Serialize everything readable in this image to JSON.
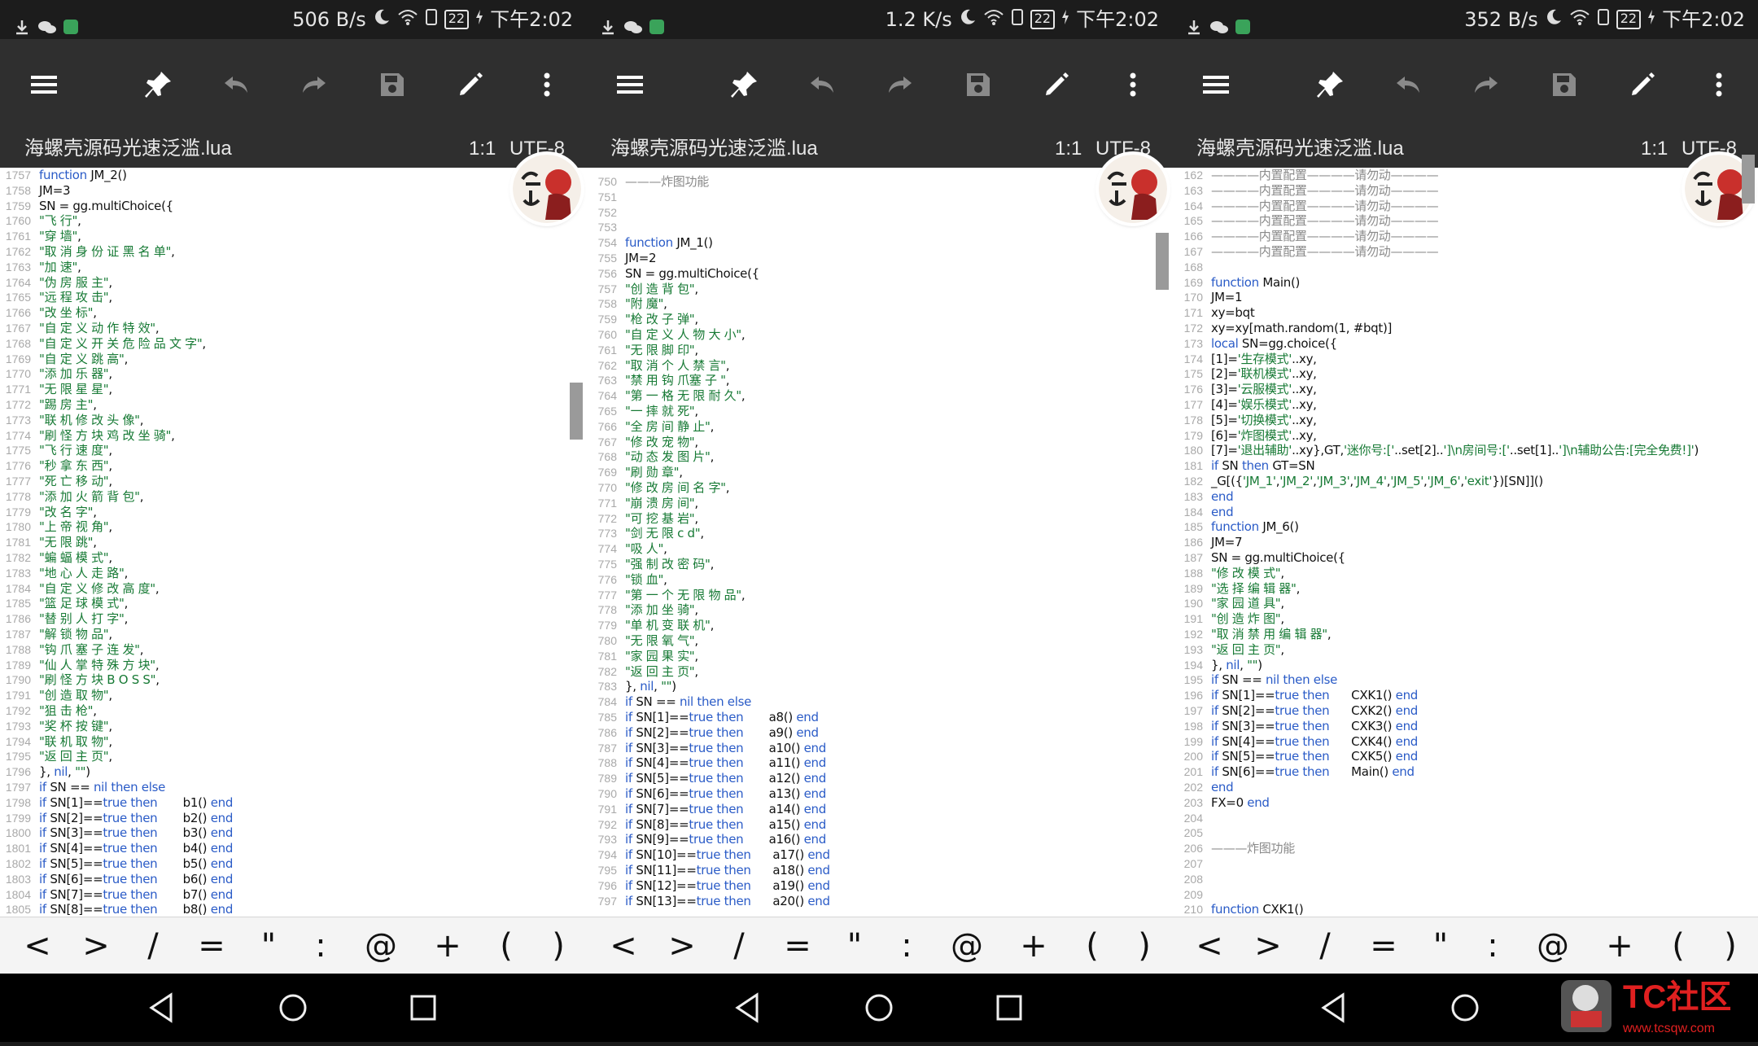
{
  "panels": [
    {
      "status": {
        "speed": "506 B/s",
        "battery": "22",
        "time": "下午2:02"
      },
      "file": {
        "name": "海螺壳源码光速泛滥.lua",
        "position": "1:1",
        "encoding": "UTF-8"
      },
      "lines": [
        [
          "1757",
          "function JM_2()"
        ],
        [
          "1758",
          "JM=3"
        ],
        [
          "1759",
          "SN = gg.multiChoice({"
        ],
        [
          "1760",
          "\"飞 行\","
        ],
        [
          "1761",
          "\"穿 墙\","
        ],
        [
          "1762",
          "\"取 消 身 份 证 黑 名 单\","
        ],
        [
          "1763",
          "\"加 速\","
        ],
        [
          "1764",
          "\"伪 房 服 主\","
        ],
        [
          "1765",
          "\"远 程 攻 击\","
        ],
        [
          "1766",
          "\"改 坐 标\","
        ],
        [
          "1767",
          "\"自 定 义 动 作 特 效\","
        ],
        [
          "1768",
          "\"自 定 义 开 关 危 险 品 文 字\","
        ],
        [
          "1769",
          "\"自 定 义 跳 高\","
        ],
        [
          "1770",
          "\"添 加 乐 器\","
        ],
        [
          "1771",
          "\"无 限 星 星\","
        ],
        [
          "1772",
          "\"踢 房 主\","
        ],
        [
          "1773",
          "\"联 机 修 改 头 像\","
        ],
        [
          "1774",
          "\"刷 怪 方 块 鸡 改 坐 骑\","
        ],
        [
          "1775",
          "\"飞 行 速 度\","
        ],
        [
          "1776",
          "\"秒 拿 东 西\","
        ],
        [
          "1777",
          "\"死 亡 移 动\","
        ],
        [
          "1778",
          "\"添 加 火 箭 背 包\","
        ],
        [
          "1779",
          "\"改 名 字\","
        ],
        [
          "1780",
          "\"上 帝 视 角\","
        ],
        [
          "1781",
          "\"无 限 跳\","
        ],
        [
          "1782",
          "\"蝙 蝠 模 式\","
        ],
        [
          "1783",
          "\"地 心 人 走 路\","
        ],
        [
          "1784",
          "\"自 定 义 修 改 高 度\","
        ],
        [
          "1785",
          "\"篮 足 球 模 式\","
        ],
        [
          "1786",
          "\"替 别 人 打 字\","
        ],
        [
          "1787",
          "\"解 锁 物 品\","
        ],
        [
          "1788",
          "\"钩 爪 塞 子 连 发\","
        ],
        [
          "1789",
          "\"仙 人 掌 特 殊 方 块\","
        ],
        [
          "1790",
          "\"刷 怪 方 块 B O S S\","
        ],
        [
          "1791",
          "\"创 造 取 物\","
        ],
        [
          "1792",
          "\"狙 击 枪\","
        ],
        [
          "1793",
          "\"奖 杯 按 键\","
        ],
        [
          "1794",
          "\"联 机 取 物\","
        ],
        [
          "1795",
          "\"返 回 主 页\","
        ],
        [
          "1796",
          "}, nil, \"\")"
        ],
        [
          "1797",
          "if SN == nil then else"
        ],
        [
          "1798",
          "if SN[1]==true then       b1() end"
        ],
        [
          "1799",
          "if SN[2]==true then       b2() end"
        ],
        [
          "1800",
          "if SN[3]==true then       b3() end"
        ],
        [
          "1801",
          "if SN[4]==true then       b4() end"
        ],
        [
          "1802",
          "if SN[5]==true then       b5() end"
        ],
        [
          "1803",
          "if SN[6]==true then       b6() end"
        ],
        [
          "1804",
          "if SN[7]==true then       b7() end"
        ],
        [
          "1805",
          "if SN[8]==true then       b8() end"
        ]
      ]
    },
    {
      "status": {
        "speed": "1.2 K/s",
        "battery": "22",
        "time": "下午2:02"
      },
      "file": {
        "name": "海螺壳源码光速泛滥.lua",
        "position": "1:1",
        "encoding": "UTF-8"
      },
      "lines": [
        [
          "750",
          "———炸图功能"
        ],
        [
          "751",
          ""
        ],
        [
          "752",
          ""
        ],
        [
          "753",
          ""
        ],
        [
          "754",
          "function JM_1()"
        ],
        [
          "755",
          "JM=2"
        ],
        [
          "756",
          "SN = gg.multiChoice({"
        ],
        [
          "757",
          "\"创 造 背 包\","
        ],
        [
          "758",
          "\"附 魔\","
        ],
        [
          "759",
          "\"枪 改 子 弹\","
        ],
        [
          "760",
          "\"自 定 义 人 物 大 小\","
        ],
        [
          "761",
          "\"无 限 脚 印\","
        ],
        [
          "762",
          "\"取 消 个 人 禁 言\","
        ],
        [
          "763",
          "\"禁 用 钩 爪塞 子 \","
        ],
        [
          "764",
          "\"第 一 格 无 限 耐 久\","
        ],
        [
          "765",
          "\"一 摔 就 死\","
        ],
        [
          "766",
          "\"全 房 间 静 止\","
        ],
        [
          "767",
          "\"修 改 宠 物\","
        ],
        [
          "768",
          "\"动 态 发 图 片\","
        ],
        [
          "769",
          "\"刷 勋 章\","
        ],
        [
          "770",
          "\"修 改 房 间 名 字\","
        ],
        [
          "771",
          "\"崩 溃 房 间\","
        ],
        [
          "772",
          "\"可 挖 基 岩\","
        ],
        [
          "773",
          "\"剑 无 限 c d\","
        ],
        [
          "774",
          "\"吸 人\","
        ],
        [
          "775",
          "\"强 制 改 密 码\","
        ],
        [
          "776",
          "\"锁 血\","
        ],
        [
          "777",
          "\"第 一 个 无 限 物 品\","
        ],
        [
          "778",
          "\"添 加 坐 骑\","
        ],
        [
          "779",
          "\"单 机 变 联 机\","
        ],
        [
          "780",
          "\"无 限 氧 气\","
        ],
        [
          "781",
          "\"家 园 果 实\","
        ],
        [
          "782",
          "\"返 回 主 页\","
        ],
        [
          "783",
          "}, nil, \"\")"
        ],
        [
          "784",
          "if SN == nil then else"
        ],
        [
          "785",
          "if SN[1]==true then       a8() end"
        ],
        [
          "786",
          "if SN[2]==true then       a9() end"
        ],
        [
          "787",
          "if SN[3]==true then       a10() end"
        ],
        [
          "788",
          "if SN[4]==true then       a11() end"
        ],
        [
          "789",
          "if SN[5]==true then       a12() end"
        ],
        [
          "790",
          "if SN[6]==true then       a13() end"
        ],
        [
          "791",
          "if SN[7]==true then       a14() end"
        ],
        [
          "792",
          "if SN[8]==true then       a15() end"
        ],
        [
          "793",
          "if SN[9]==true then       a16() end"
        ],
        [
          "794",
          "if SN[10]==true then      a17() end"
        ],
        [
          "795",
          "if SN[11]==true then      a18() end"
        ],
        [
          "796",
          "if SN[12]==true then      a19() end"
        ],
        [
          "797",
          "if SN[13]==true then      a20() end"
        ]
      ]
    },
    {
      "status": {
        "speed": "352 B/s",
        "battery": "22",
        "time": "下午2:02"
      },
      "file": {
        "name": "海螺壳源码光速泛滥.lua",
        "position": "1:1",
        "encoding": "UTF-8"
      },
      "lines": [
        [
          "162",
          "————内置配置————请勿动————"
        ],
        [
          "163",
          "————内置配置————请勿动————"
        ],
        [
          "164",
          "————内置配置————请勿动————"
        ],
        [
          "165",
          "————内置配置————请勿动————"
        ],
        [
          "166",
          "————内置配置————请勿动————"
        ],
        [
          "167",
          "————内置配置————请勿动————"
        ],
        [
          "168",
          ""
        ],
        [
          "169",
          "function Main()"
        ],
        [
          "170",
          "JM=1"
        ],
        [
          "171",
          "xy=bqt"
        ],
        [
          "172",
          "xy=xy[math.random(1, #bqt)]"
        ],
        [
          "173",
          "local SN=gg.choice({"
        ],
        [
          "174",
          "[1]='生存模式'..xy,"
        ],
        [
          "175",
          "[2]='联机模式'..xy,"
        ],
        [
          "176",
          "[3]='云服模式'..xy,"
        ],
        [
          "177",
          "[4]='娱乐模式'..xy,"
        ],
        [
          "178",
          "[5]='切换模式'..xy,"
        ],
        [
          "179",
          "[6]='炸图模式'..xy,"
        ],
        [
          "180",
          "[7]='退出辅助'..xy},GT,'迷你号:['..set[2]..']\\n房间号:['..set[1]..']\\n辅助公告:[完全免费!]')"
        ],
        [
          "181",
          "if SN then GT=SN"
        ],
        [
          "182",
          "_G[({'JM_1','JM_2','JM_3','JM_4','JM_5','JM_6','exit'})[SN]]()"
        ],
        [
          "183",
          "end"
        ],
        [
          "184",
          "end"
        ],
        [
          "185",
          "function JM_6()"
        ],
        [
          "186",
          "JM=7"
        ],
        [
          "187",
          "SN = gg.multiChoice({"
        ],
        [
          "188",
          "\"修 改 模 式\","
        ],
        [
          "189",
          "\"选 择 编 辑 器\","
        ],
        [
          "190",
          "\"家 园 道 具\","
        ],
        [
          "191",
          "\"创 造 炸 图\","
        ],
        [
          "192",
          "\"取 消 禁 用 编 辑 器\","
        ],
        [
          "193",
          "\"返 回 主 页\","
        ],
        [
          "194",
          "}, nil, \"\")"
        ],
        [
          "195",
          "if SN == nil then else"
        ],
        [
          "196",
          "if SN[1]==true then      CXK1() end"
        ],
        [
          "197",
          "if SN[2]==true then      CXK2() end"
        ],
        [
          "198",
          "if SN[3]==true then      CXK3() end"
        ],
        [
          "199",
          "if SN[4]==true then      CXK4() end"
        ],
        [
          "200",
          "if SN[5]==true then      CXK5() end"
        ],
        [
          "201",
          "if SN[6]==true then      Main() end"
        ],
        [
          "202",
          "end"
        ],
        [
          "203",
          "FX=0 end"
        ],
        [
          "204",
          ""
        ],
        [
          "205",
          ""
        ],
        [
          "206",
          "———炸图功能"
        ],
        [
          "207",
          ""
        ],
        [
          "208",
          ""
        ],
        [
          "209",
          ""
        ],
        [
          "210",
          "function CXK1()"
        ]
      ]
    }
  ],
  "symbols": [
    "<",
    ">",
    "/",
    "=",
    "\"",
    ":",
    "@",
    "+",
    "(",
    ")"
  ],
  "icons": {
    "menu": "menu-icon",
    "pin": "pin-icon",
    "undo": "undo-icon",
    "redo": "redo-icon",
    "save": "save-icon",
    "edit": "pencil-icon",
    "more": "more-vert-icon"
  },
  "watermark": {
    "brand": "TC社区",
    "url": "www.tcsqw.com"
  },
  "colors": {
    "toolbar": "#2f2f2f",
    "keyword": "#2a5bc7",
    "string": "#177a35"
  }
}
